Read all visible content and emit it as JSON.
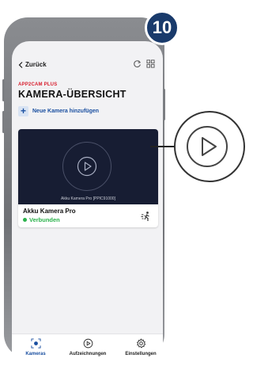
{
  "header": {
    "back_label": "Zurück",
    "brand": "APP2CAM PLUS",
    "title": "KAMERA-ÜBERSICHT",
    "add_label": "Neue Kamera hinzufügen",
    "icons": [
      "refresh-icon",
      "grid-view-icon"
    ]
  },
  "camera": {
    "preview_label": "Akku Kamera Pro [PPIC91000]",
    "name": "Akku Kamera Pro",
    "status": "Verbunden",
    "status_color": "#2bb24c"
  },
  "nav": {
    "items": [
      {
        "label": "Kameras",
        "icon": "camera-icon",
        "active": true
      },
      {
        "label": "Aufzeichnungen",
        "icon": "play-circle-icon",
        "active": false
      },
      {
        "label": "Einstellungen",
        "icon": "settings-gear-icon",
        "active": false
      }
    ]
  },
  "step_badge": "10",
  "colors": {
    "accent": "#1a4fa0",
    "brand_red": "#d8202f",
    "badge_bg": "#193a6b",
    "preview_bg": "#171d33"
  }
}
